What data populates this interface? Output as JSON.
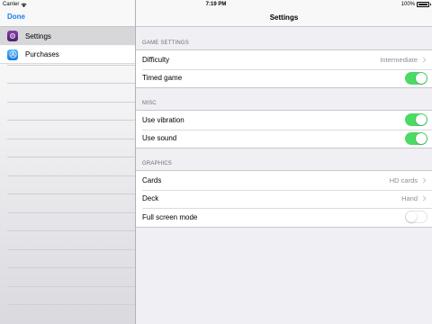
{
  "status_bar": {
    "carrier": "Carrier",
    "time": "7:19 PM",
    "battery": "100%"
  },
  "sidebar": {
    "done_label": "Done",
    "items": [
      {
        "label": "Settings",
        "icon": "settings-icon",
        "selected": true
      },
      {
        "label": "Purchases",
        "icon": "app-store-icon",
        "selected": false
      }
    ]
  },
  "main": {
    "title": "Settings",
    "sections": [
      {
        "header": "GAME SETTINGS",
        "rows": [
          {
            "label": "Difficulty",
            "value": "Intermediate",
            "type": "disclosure"
          },
          {
            "label": "Timed game",
            "type": "toggle",
            "on": true
          }
        ]
      },
      {
        "header": "MISC",
        "rows": [
          {
            "label": "Use vibration",
            "type": "toggle",
            "on": true
          },
          {
            "label": "Use sound",
            "type": "toggle",
            "on": true
          }
        ]
      },
      {
        "header": "GRAPHICS",
        "rows": [
          {
            "label": "Cards",
            "value": "HD cards",
            "type": "disclosure"
          },
          {
            "label": "Deck",
            "value": "Hand",
            "type": "disclosure"
          },
          {
            "label": "Full screen mode",
            "type": "toggle",
            "on": false
          }
        ]
      }
    ]
  },
  "colors": {
    "accent": "#1a7ef2",
    "toggle_on": "#4cd964",
    "secondary_text": "#8e8e93",
    "section_header": "#6d6d72"
  }
}
